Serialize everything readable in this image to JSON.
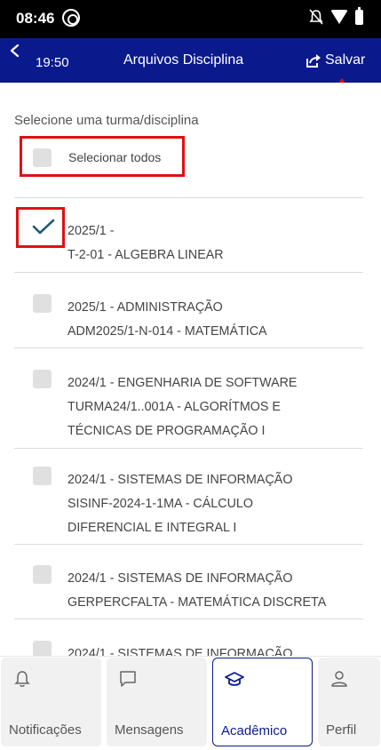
{
  "status_bar": {
    "time": "08:46"
  },
  "app_bar": {
    "time": "19:50",
    "title": "Arquivos Disciplina",
    "save_label": "Salvar"
  },
  "content": {
    "instruction": "Selecione uma turma/disciplina",
    "select_all_label": "Selecionar todos",
    "items": [
      {
        "line1": "2025/1 -",
        "line2": "T-2-01 - ALGEBRA LINEAR",
        "line3": "",
        "checked": true
      },
      {
        "line1": "2025/1 - ADMINISTRAÇÃO",
        "line2": "ADM2025/1-N-014 - MATEMÁTICA",
        "line3": "",
        "checked": false
      },
      {
        "line1": "2024/1 - ENGENHARIA DE SOFTWARE",
        "line2": "TURMA24/1..001A - ALGORÍTMOS E",
        "line3": "TÉCNICAS DE PROGRAMAÇÃO I",
        "checked": false
      },
      {
        "line1": "2024/1 - SISTEMAS DE INFORMAÇÃO",
        "line2": "SISINF-2024-1-1MA - CÁLCULO",
        "line3": "DIFERENCIAL E INTEGRAL I",
        "checked": false
      },
      {
        "line1": "2024/1 - SISTEMAS DE INFORMAÇÃO",
        "line2": "GERPERCFALTA - MATEMÁTICA DISCRETA",
        "line3": "",
        "checked": false
      },
      {
        "line1": "2024/1 - SISTEMAS DE INFORMAÇÃO",
        "line2": "",
        "line3": "",
        "checked": false
      }
    ]
  },
  "tabs": [
    {
      "label": "Notificações",
      "icon": "bell-icon",
      "active": false
    },
    {
      "label": "Mensagens",
      "icon": "message-icon",
      "active": false
    },
    {
      "label": "Acadêmico",
      "icon": "graduation-cap-icon",
      "active": true
    },
    {
      "label": "Perfil",
      "icon": "person-icon",
      "active": false
    }
  ],
  "colors": {
    "app_bar": "#0a1a8c",
    "highlight": "#e01010",
    "checkmark": "#1f5b7a"
  }
}
